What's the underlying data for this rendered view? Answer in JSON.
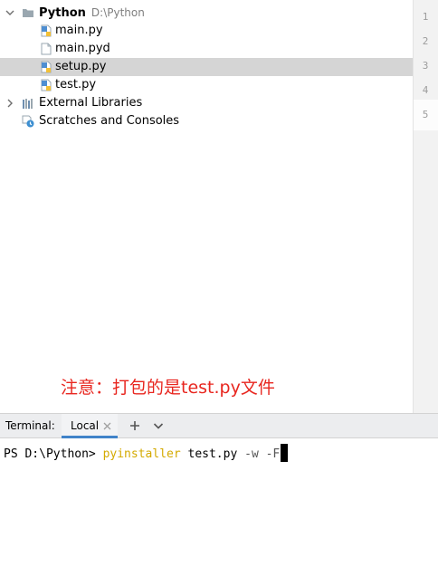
{
  "project": {
    "root": {
      "name": "Python",
      "path": "D:\\Python"
    },
    "files": [
      {
        "name": "main.py"
      },
      {
        "name": "main.pyd"
      },
      {
        "name": "setup.py",
        "selected": true
      },
      {
        "name": "test.py"
      }
    ],
    "external_libraries": "External Libraries",
    "scratches": "Scratches and Consoles"
  },
  "gutter": {
    "line_numbers": [
      "1",
      "2",
      "3",
      "4",
      "5"
    ]
  },
  "annotation": {
    "text": "注意：打包的是test.py文件",
    "color": "#e8261f"
  },
  "terminal": {
    "title": "Terminal:",
    "tab_label": "Local",
    "prompt": "PS D:\\Python> ",
    "command": "pyinstaller",
    "args": " test.py ",
    "flags": "-w -F"
  },
  "colors": {
    "selection": "#d5d5d5",
    "tab_underline": "#4083c9",
    "command": "#d4aa00"
  }
}
